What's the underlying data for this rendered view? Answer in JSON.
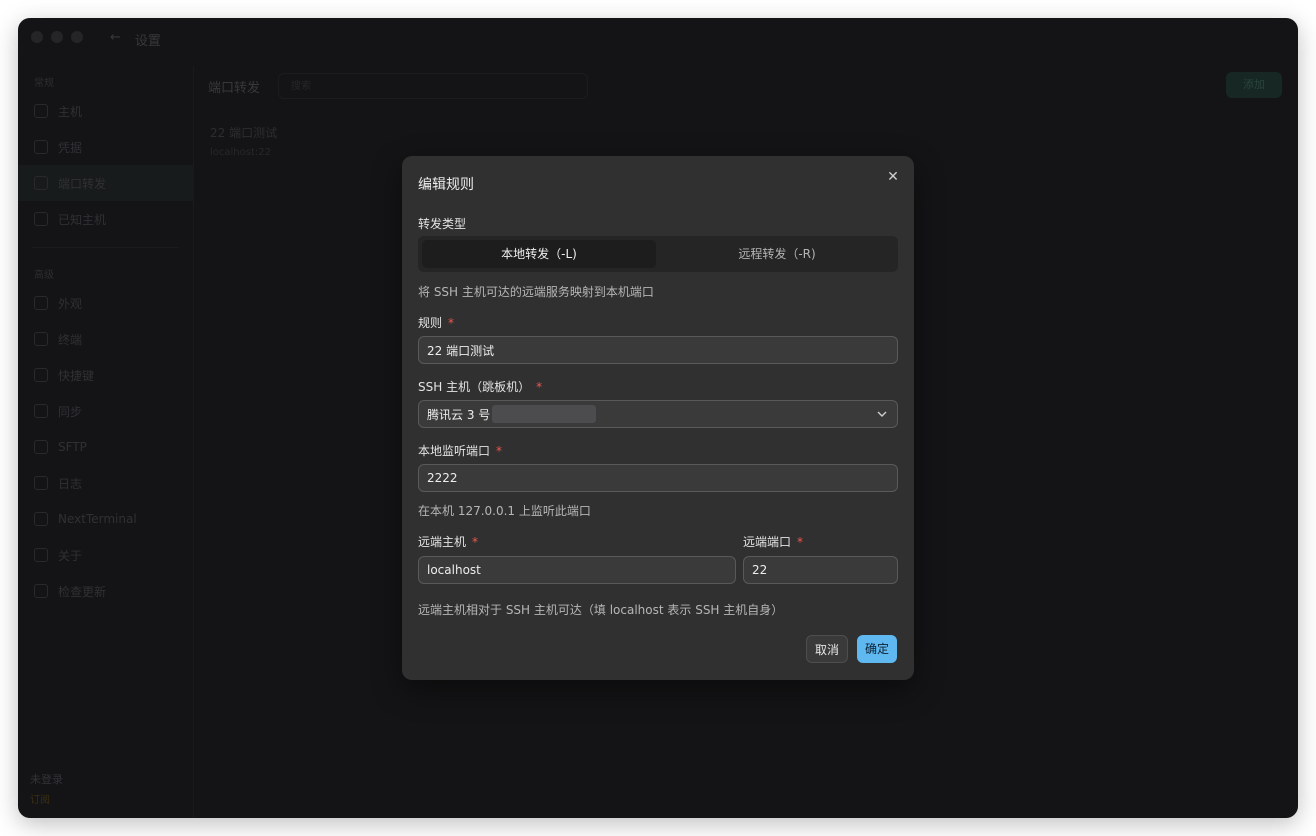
{
  "window": {
    "title": "设置",
    "back_icon": "arrow-left-icon"
  },
  "sidebar": {
    "section1": "常规",
    "section2": "高级",
    "items": [
      {
        "label": "主机",
        "icon": "edit-icon"
      },
      {
        "label": "凭据",
        "icon": "key-icon"
      },
      {
        "label": "端口转发",
        "icon": "forward-icon"
      },
      {
        "label": "已知主机",
        "icon": "list-icon"
      }
    ],
    "items2": [
      {
        "label": "外观",
        "icon": "palette-icon"
      },
      {
        "label": "终端",
        "icon": "terminal-icon"
      },
      {
        "label": "快捷键",
        "icon": "keyboard-icon"
      },
      {
        "label": "同步",
        "icon": "sync-icon"
      },
      {
        "label": "SFTP",
        "icon": "folder-icon"
      },
      {
        "label": "日志",
        "icon": "log-icon"
      },
      {
        "label": "NextTerminal",
        "icon": "server-icon"
      },
      {
        "label": "关于",
        "icon": "info-icon"
      },
      {
        "label": "检查更新",
        "icon": "update-icon"
      }
    ],
    "footer_name": "未登录",
    "footer_sub": "订阅"
  },
  "main": {
    "title": "端口转发",
    "search_placeholder": "搜索",
    "add_label": "添加",
    "rule_name": "22 端口测试",
    "rule_meta": "localhost:22"
  },
  "modal": {
    "title": "编辑规则",
    "close_icon": "close-icon",
    "forward_type_label": "转发类型",
    "seg_local": "本地转发（-L)",
    "seg_remote": "远程转发（-R)",
    "type_hint": "将 SSH 主机可达的远端服务映射到本机端口",
    "rule_label": "规则",
    "rule_value": "22 端口测试",
    "host_label": "SSH 主机（跳板机）",
    "host_value": "腾讯云 3 号",
    "local_port_label": "本地监听端口",
    "local_port_value": "2222",
    "local_port_hint": "在本机 127.0.0.1 上监听此端口",
    "remote_host_label": "远端主机",
    "remote_host_value": "localhost",
    "remote_port_label": "远端端口",
    "remote_port_value": "22",
    "remote_hint": "远端主机相对于 SSH 主机可达（填 localhost 表示 SSH 主机自身）",
    "required_mark": "*",
    "cancel": "取消",
    "ok": "确定"
  },
  "colors": {
    "accent": "#5fb8f0",
    "required": "#f0564e",
    "modal_bg": "#303031"
  }
}
